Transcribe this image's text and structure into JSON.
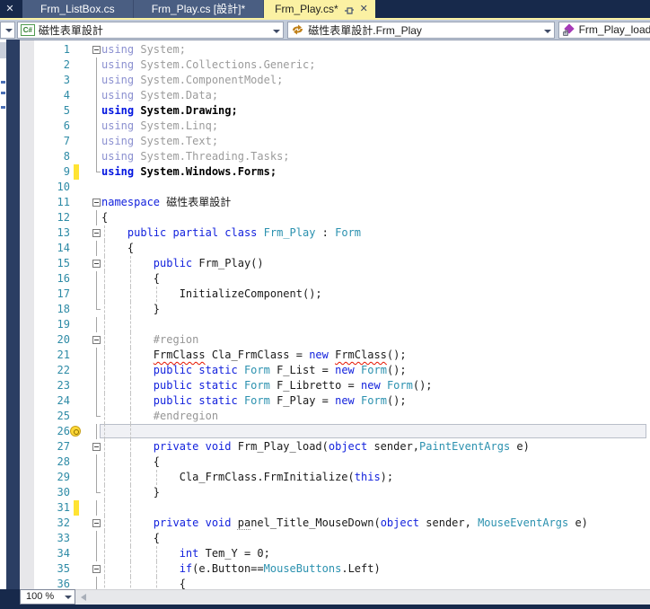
{
  "window": {
    "bg_color": "#17294B",
    "accent_active_tab": "#FBF1A3"
  },
  "left_panel": {
    "close_label": "✕"
  },
  "tabs": [
    {
      "label": "Frm_ListBox.cs",
      "active": false
    },
    {
      "label": "Frm_Play.cs [設計]*",
      "active": false
    },
    {
      "label": "Frm_Play.cs*",
      "active": true
    }
  ],
  "navbar": {
    "project": {
      "icon": "csharp-project-icon",
      "icon_text": "C#",
      "label": "磁性表單設計"
    },
    "type": {
      "icon": "class-icon",
      "label": "磁性表單設計.Frm_Play"
    },
    "member": {
      "icon": "method-private-icon",
      "label": "Frm_Play_load"
    }
  },
  "statusbar": {
    "zoom": "100 %"
  },
  "editor": {
    "current_line": 26,
    "colors": {
      "keyword": "#1322DD",
      "type": "#2B91AF",
      "grayed": "#9B9B9B",
      "line_number": "#2E8BA6",
      "error_squiggle": "#E51400",
      "change_bar": "#FFE333"
    },
    "lines": [
      {
        "n": 1,
        "fold": "box",
        "tokens": [
          [
            "gk",
            "using"
          ],
          [
            "g",
            " System;"
          ]
        ]
      },
      {
        "n": 2,
        "fold": "line",
        "tokens": [
          [
            "gk",
            "using"
          ],
          [
            "g",
            " System.Collections.Generic;"
          ]
        ]
      },
      {
        "n": 3,
        "fold": "line",
        "tokens": [
          [
            "gk",
            "using"
          ],
          [
            "g",
            " System.ComponentModel;"
          ]
        ]
      },
      {
        "n": 4,
        "fold": "line",
        "tokens": [
          [
            "gk",
            "using"
          ],
          [
            "g",
            " System.Data;"
          ]
        ]
      },
      {
        "n": 5,
        "fold": "line",
        "tokens": [
          [
            "kb",
            "using"
          ],
          [
            "db",
            " System.Drawing;"
          ]
        ]
      },
      {
        "n": 6,
        "fold": "line",
        "tokens": [
          [
            "gk",
            "using"
          ],
          [
            "g",
            " System.Linq;"
          ]
        ]
      },
      {
        "n": 7,
        "fold": "line",
        "tokens": [
          [
            "gk",
            "using"
          ],
          [
            "g",
            " System.Text;"
          ]
        ]
      },
      {
        "n": 8,
        "fold": "line",
        "tokens": [
          [
            "gk",
            "using"
          ],
          [
            "g",
            " System.Threading.Tasks;"
          ]
        ]
      },
      {
        "n": 9,
        "fold": "end",
        "chg": true,
        "tokens": [
          [
            "kb",
            "using"
          ],
          [
            "db",
            " System.Windows.Forms;"
          ]
        ]
      },
      {
        "n": 10,
        "tokens": []
      },
      {
        "n": 11,
        "fold": "box",
        "tokens": [
          [
            "k",
            "namespace"
          ],
          [
            "d",
            " 磁性表單設計"
          ]
        ]
      },
      {
        "n": 12,
        "fold": "line",
        "tokens": [
          [
            "d",
            "{"
          ]
        ]
      },
      {
        "n": 13,
        "fold": "box",
        "guides": [
          0
        ],
        "tokens": [
          [
            "d",
            "    "
          ],
          [
            "k",
            "public partial class"
          ],
          [
            "d",
            " "
          ],
          [
            "t",
            "Frm_Play"
          ],
          [
            "d",
            " : "
          ],
          [
            "t",
            "Form"
          ]
        ]
      },
      {
        "n": 14,
        "fold": "line",
        "guides": [
          0
        ],
        "tokens": [
          [
            "d",
            "    {"
          ]
        ]
      },
      {
        "n": 15,
        "fold": "box",
        "guides": [
          0,
          4
        ],
        "tokens": [
          [
            "d",
            "        "
          ],
          [
            "k",
            "public"
          ],
          [
            "d",
            " Frm_Play()"
          ]
        ]
      },
      {
        "n": 16,
        "fold": "line",
        "guides": [
          0,
          4
        ],
        "tokens": [
          [
            "d",
            "        {"
          ]
        ]
      },
      {
        "n": 17,
        "fold": "line",
        "guides": [
          0,
          4,
          8
        ],
        "tokens": [
          [
            "d",
            "            InitializeComponent();"
          ]
        ]
      },
      {
        "n": 18,
        "fold": "end",
        "guides": [
          0,
          4
        ],
        "tokens": [
          [
            "d",
            "        }"
          ]
        ]
      },
      {
        "n": 19,
        "fold": "line",
        "guides": [
          0,
          4
        ],
        "tokens": []
      },
      {
        "n": 20,
        "fold": "box",
        "guides": [
          0,
          4
        ],
        "tokens": [
          [
            "d",
            "        "
          ],
          [
            "pp",
            "#region"
          ]
        ]
      },
      {
        "n": 21,
        "fold": "line",
        "guides": [
          0,
          4
        ],
        "tokens": [
          [
            "d",
            "        "
          ],
          [
            "err",
            "FrmClass"
          ],
          [
            "d",
            " Cla_FrmClass = "
          ],
          [
            "k",
            "new"
          ],
          [
            "d",
            " "
          ],
          [
            "err",
            "FrmClass"
          ],
          [
            "d",
            "();"
          ]
        ]
      },
      {
        "n": 22,
        "fold": "line",
        "guides": [
          0,
          4
        ],
        "tokens": [
          [
            "d",
            "        "
          ],
          [
            "k",
            "public static"
          ],
          [
            "d",
            " "
          ],
          [
            "t",
            "Form"
          ],
          [
            "d",
            " F_List = "
          ],
          [
            "k",
            "new"
          ],
          [
            "d",
            " "
          ],
          [
            "t",
            "Form"
          ],
          [
            "d",
            "();"
          ]
        ]
      },
      {
        "n": 23,
        "fold": "line",
        "guides": [
          0,
          4
        ],
        "tokens": [
          [
            "d",
            "        "
          ],
          [
            "k",
            "public static"
          ],
          [
            "d",
            " "
          ],
          [
            "t",
            "Form"
          ],
          [
            "d",
            " F_Libretto = "
          ],
          [
            "k",
            "new"
          ],
          [
            "d",
            " "
          ],
          [
            "t",
            "Form"
          ],
          [
            "d",
            "();"
          ]
        ]
      },
      {
        "n": 24,
        "fold": "line",
        "guides": [
          0,
          4
        ],
        "tokens": [
          [
            "d",
            "        "
          ],
          [
            "k",
            "public static"
          ],
          [
            "d",
            " "
          ],
          [
            "t",
            "Form"
          ],
          [
            "d",
            " F_Play = "
          ],
          [
            "k",
            "new"
          ],
          [
            "d",
            " "
          ],
          [
            "t",
            "Form"
          ],
          [
            "d",
            "();"
          ]
        ]
      },
      {
        "n": 25,
        "fold": "end",
        "guides": [
          0,
          4
        ],
        "tokens": [
          [
            "d",
            "        "
          ],
          [
            "pp",
            "#endregion"
          ]
        ]
      },
      {
        "n": 26,
        "fold": "line",
        "guides": [
          0,
          4
        ],
        "bulb": true,
        "current": true,
        "tokens": []
      },
      {
        "n": 27,
        "fold": "box",
        "guides": [
          0,
          4
        ],
        "tokens": [
          [
            "d",
            "        "
          ],
          [
            "k",
            "private void"
          ],
          [
            "d",
            " Frm_Play_load("
          ],
          [
            "k",
            "object"
          ],
          [
            "d",
            " sender,"
          ],
          [
            "t",
            "PaintEventArgs"
          ],
          [
            "d",
            " e)"
          ]
        ]
      },
      {
        "n": 28,
        "fold": "line",
        "guides": [
          0,
          4
        ],
        "tokens": [
          [
            "d",
            "        {"
          ]
        ]
      },
      {
        "n": 29,
        "fold": "line",
        "guides": [
          0,
          4,
          8
        ],
        "tokens": [
          [
            "d",
            "            Cla_FrmClass.FrmInitialize("
          ],
          [
            "k",
            "this"
          ],
          [
            "d",
            ");"
          ]
        ]
      },
      {
        "n": 30,
        "fold": "end",
        "guides": [
          0,
          4
        ],
        "tokens": [
          [
            "d",
            "        }"
          ]
        ]
      },
      {
        "n": 31,
        "fold": "line",
        "guides": [
          0,
          4
        ],
        "chg": true,
        "tokens": []
      },
      {
        "n": 32,
        "fold": "box",
        "guides": [
          0,
          4
        ],
        "tokens": [
          [
            "d",
            "        "
          ],
          [
            "k",
            "private void"
          ],
          [
            "d",
            " "
          ],
          [
            "dot",
            "pa"
          ],
          [
            "d",
            "nel_Title_MouseDown("
          ],
          [
            "k",
            "object"
          ],
          [
            "d",
            " sender, "
          ],
          [
            "t",
            "MouseEventArgs"
          ],
          [
            "d",
            " e)"
          ]
        ]
      },
      {
        "n": 33,
        "fold": "line",
        "guides": [
          0,
          4
        ],
        "tokens": [
          [
            "d",
            "        {"
          ]
        ]
      },
      {
        "n": 34,
        "fold": "line",
        "guides": [
          0,
          4,
          8
        ],
        "tokens": [
          [
            "d",
            "            "
          ],
          [
            "k",
            "int"
          ],
          [
            "d",
            " Tem_Y = 0;"
          ]
        ]
      },
      {
        "n": 35,
        "fold": "box",
        "guides": [
          0,
          4,
          8
        ],
        "tokens": [
          [
            "d",
            "            "
          ],
          [
            "k",
            "if"
          ],
          [
            "d",
            "(e.Button=="
          ],
          [
            "t",
            "MouseButtons"
          ],
          [
            "d",
            ".Left)"
          ]
        ]
      },
      {
        "n": 36,
        "fold": "line",
        "guides": [
          0,
          4,
          8
        ],
        "tokens": [
          [
            "d",
            "            {"
          ]
        ]
      }
    ]
  }
}
